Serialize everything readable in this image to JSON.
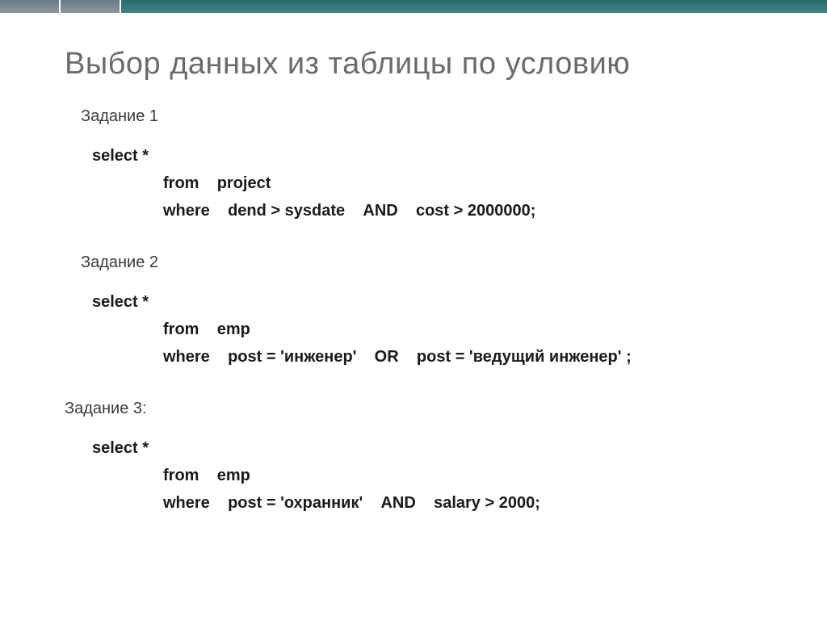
{
  "slide": {
    "title": "Выбор данных из таблицы по условию",
    "tasks": [
      {
        "label": "Задание 1",
        "code": {
          "select": "select  *",
          "from_kw": "from",
          "from_tbl": "project",
          "where_kw": "where",
          "where_cond_1": "dend > sysdate",
          "and_kw": "AND",
          "where_cond_2": "cost > 2000000;"
        }
      },
      {
        "label": "Задание 2",
        "code": {
          "select": "select  *",
          "from_kw": "from",
          "from_tbl": "emp",
          "where_kw": "where",
          "where_cond_1": "post = 'инженер'",
          "or_kw": "OR",
          "where_cond_2": "post = 'ведущий инженер' ;"
        }
      },
      {
        "label": "Задание 3:",
        "code": {
          "select": "select  *",
          "from_kw": "from",
          "from_tbl": "emp",
          "where_kw": "where",
          "where_cond_1": "post = 'охранник'",
          "and_kw": "AND",
          "where_cond_2": "salary > 2000;"
        }
      }
    ]
  }
}
